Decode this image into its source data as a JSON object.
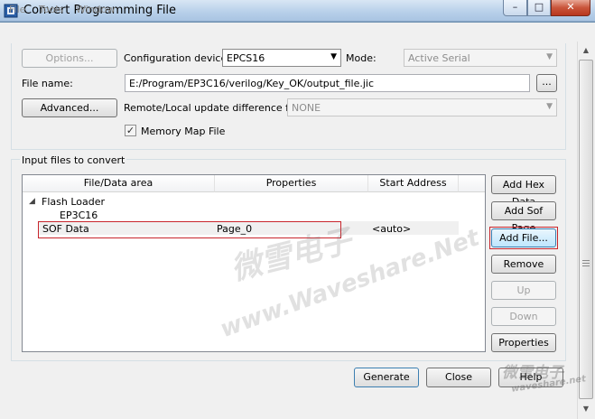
{
  "window": {
    "title": "Convert Programming File",
    "min_glyph": "–",
    "max_glyph": "□",
    "close_glyph": "✕"
  },
  "menu": {
    "file": "File",
    "tools": "Tools",
    "window": "Window"
  },
  "top": {
    "options_label": "Options...",
    "config_device_label": "Configuration device:",
    "config_device_value": "EPCS16",
    "mode_label": "Mode:",
    "mode_value": "Active Serial",
    "file_name_label": "File name:",
    "file_name_value": "E:/Program/EP3C16/verilog/Key_OK/output_file.jic",
    "browse_label": "...",
    "advanced_label": "Advanced...",
    "remote_label": "Remote/Local update difference file:",
    "remote_value": "NONE",
    "memory_map_label": "Memory Map File",
    "memory_map_checked": true
  },
  "input": {
    "group_title": "Input files to convert",
    "columns": [
      "File/Data area",
      "Properties",
      "Start Address"
    ],
    "tree": {
      "flash_loader": "Flash Loader",
      "device": "EP3C16",
      "sof_data": "SOF Data",
      "sof_properties": "Page_0",
      "sof_address": "<auto>"
    },
    "buttons": {
      "add_hex": "Add Hex Data",
      "add_sof": "Add Sof Page",
      "add_file": "Add File...",
      "remove": "Remove",
      "up": "Up",
      "down": "Down",
      "properties": "Properties"
    }
  },
  "footer": {
    "generate": "Generate",
    "close": "Close",
    "help": "Help"
  },
  "watermark": {
    "brand_cn": "微雪电子",
    "site": "www.Waveshare.Net",
    "corner_site": "waveshare.net"
  },
  "colors": {
    "highlight_border": "#c8252c",
    "title_bar": "#b9d1ea",
    "close_button": "#c9553a"
  }
}
